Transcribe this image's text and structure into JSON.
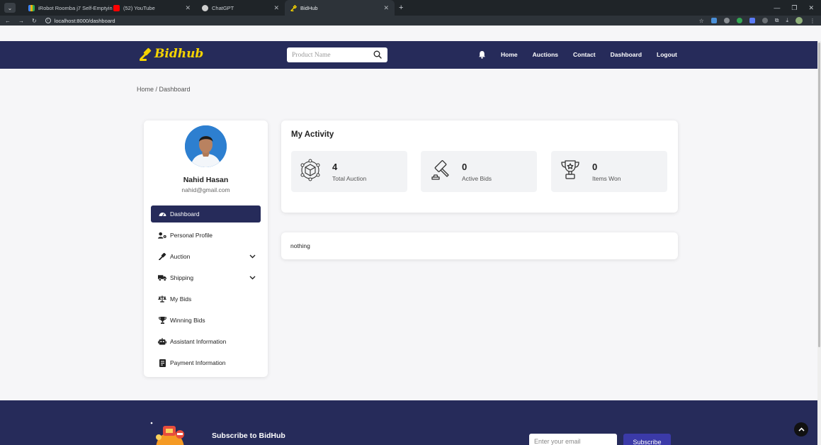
{
  "browser": {
    "tabs": [
      {
        "title": "iRobot Roomba j7 Self-Emptyin",
        "favicon_color": "#f4b400"
      },
      {
        "title": "(52) YouTube",
        "favicon_color": "#ff0000"
      },
      {
        "title": "ChatGPT",
        "favicon_color": "#cfcfcf"
      },
      {
        "title": "BidHub",
        "favicon_color": "#f5d300"
      }
    ],
    "url": "localhost:8000/dashboard"
  },
  "header": {
    "logo_text": "Bidhub",
    "search_placeholder": "Product Name",
    "nav": [
      "Home",
      "Auctions",
      "Contact",
      "Dashboard",
      "Logout"
    ]
  },
  "breadcrumb": "Home / Dashboard",
  "user": {
    "name": "Nahid Hasan",
    "email": "nahid@gmail.com"
  },
  "sidebar": {
    "items": [
      {
        "label": "Dashboard",
        "icon": "gauge-icon",
        "active": true
      },
      {
        "label": "Personal Profile",
        "icon": "user-gear-icon"
      },
      {
        "label": "Auction",
        "icon": "gavel-icon",
        "has_dropdown": true
      },
      {
        "label": "Shipping",
        "icon": "truck-icon",
        "has_dropdown": true
      },
      {
        "label": "My Bids",
        "icon": "balance-scale-icon"
      },
      {
        "label": "Winning Bids",
        "icon": "trophy-icon"
      },
      {
        "label": "Assistant Information",
        "icon": "robot-icon"
      },
      {
        "label": "Payment Information",
        "icon": "receipt-icon"
      }
    ]
  },
  "activity": {
    "title": "My Activity",
    "stats": [
      {
        "value": "4",
        "label": "Total Auction",
        "icon": "cube-network-icon"
      },
      {
        "value": "0",
        "label": "Active Bids",
        "icon": "gavel-icon"
      },
      {
        "value": "0",
        "label": "Items Won",
        "icon": "trophy-icon"
      }
    ]
  },
  "empty_message": "nothing",
  "footer": {
    "subscribe_title": "Subscribe to BidHub",
    "email_placeholder": "Enter your email",
    "subscribe_button": "Subscribe"
  },
  "colors": {
    "brand_navy": "#262b5a",
    "logo_yellow": "#f5d300",
    "subscribe_blue": "#3b3aa8"
  }
}
